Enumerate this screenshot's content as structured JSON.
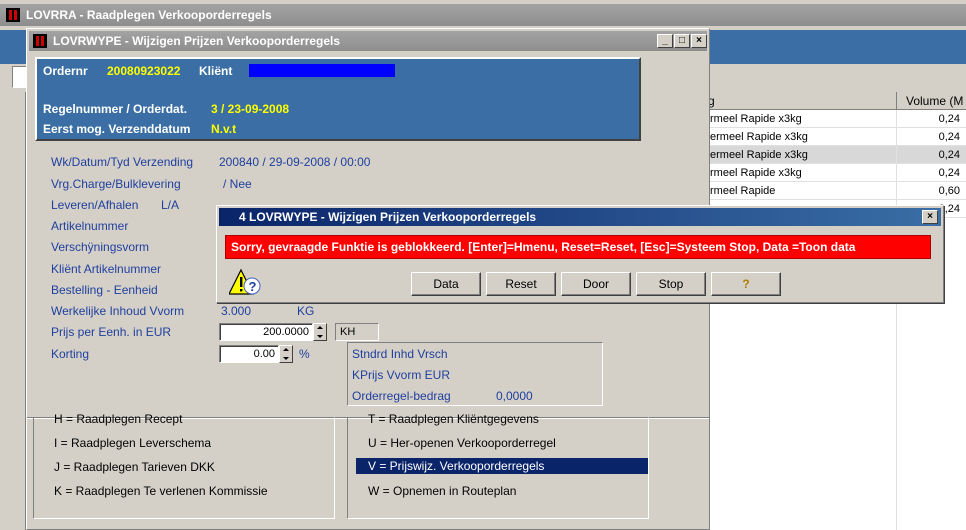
{
  "main_window": {
    "title": "LOVRRA - Raadplegen Verkooporderregels"
  },
  "grid": {
    "col_partial_header": "g",
    "col_volume_header": "Volume (M",
    "rows": [
      {
        "name": "rmeel Rapide x3kg",
        "volume": "0,24"
      },
      {
        "name": "ermeel Rapide x3kg",
        "volume": "0,24"
      },
      {
        "name": "ermeel Rapide x3kg",
        "volume": "0,24"
      },
      {
        "name": "rmeel Rapide x3kg",
        "volume": "0,24"
      },
      {
        "name": "rmeel Rapide",
        "volume": "0,60"
      },
      {
        "name": "",
        "volume": "0,24"
      }
    ]
  },
  "edit_window": {
    "title": "LOVRWYPE - Wijzigen Prijzen Verkooporderregels",
    "header": {
      "ordernr_label": "Ordernr",
      "ordernr_value": "20080923022",
      "klient_label": "Kliënt",
      "regelnummer_label": "Regelnummer / Orderdat.",
      "regelnummer_value": "3 / 23-09-2008",
      "verzend_label": "Eerst mog. Verzenddatum",
      "verzend_value": "N.v.t"
    },
    "fields": {
      "wk_label": "Wk/Datum/Tyd Verzending",
      "wk_value": "200840 / 29-09-2008 / 00:00",
      "vrg_label": "Vrg.Charge/Bulklevering",
      "vrg_value": "/ Nee",
      "leveren_label": "Leveren/Afhalen",
      "leveren_value": "L/A",
      "artikel_label": "Artikelnummer",
      "verschyn_label": "Verschÿningsvorm",
      "klient_art_label": "Kliënt Artikelnummer",
      "bestelling_label": "Bestelling - Eenheid",
      "werkelijke_label": "Werkelijke Inhoud Vvorm",
      "werkelijke_value": "3.000",
      "werkelijke_unit": "KG",
      "prijs_label": "Prijs per Eenh. in EUR",
      "prijs_value": "200.0000",
      "prijs_unit": "KH",
      "korting_label": "Korting",
      "korting_value": "0.00",
      "korting_unit": "%"
    },
    "info_box": {
      "line1": "Stndrd Inhd Vrsch",
      "line2": "KPrijs Vvorm  EUR",
      "line3_label": "Orderregel-bedrag",
      "line3_value": "0,0000"
    }
  },
  "menu": {
    "left": [
      "H = Raadplegen Recept",
      "I = Raadplegen Leverschema",
      "J = Raadplegen Tarieven DKK",
      "K = Raadplegen Te verlenen Kommissie"
    ],
    "right": [
      "T = Raadplegen Kliëntgegevens",
      "U = Her-openen Verkooporderregel",
      "V = Prijswijz. Verkooporderregels",
      "W = Opnemen in Routeplan"
    ]
  },
  "dialog": {
    "title": "4 LOVRWYPE - Wijzigen Prijzen Verkooporderregels",
    "message": "Sorry, gevraagde Funktie is geblokkeerd.  [Enter]=Hmenu, Reset=Reset, [Esc]=Systeem Stop, Data =Toon data",
    "buttons": {
      "data": "Data",
      "reset": "Reset",
      "door": "Door",
      "stop": "Stop",
      "help": "?"
    },
    "icons": [
      "warning-icon",
      "help-icon"
    ],
    "colors": {
      "message_bg": "#ff0000",
      "message_fg": "#ffffff"
    }
  },
  "colors": {
    "header_blue": "#3a6ea5",
    "highlight_yellow": "#ffff00",
    "klient_bar": "#0000ff",
    "selected_menu": "#0a246a"
  }
}
